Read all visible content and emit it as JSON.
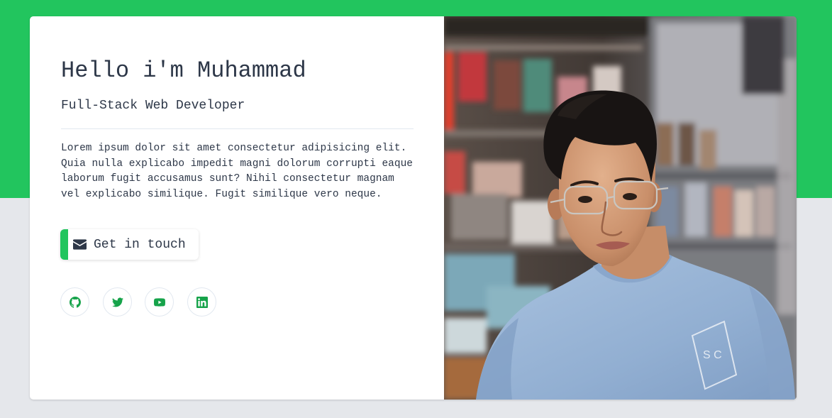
{
  "colors": {
    "accent": "#22c55e",
    "icon_green": "#16a34a",
    "text": "#2d3748",
    "page_background": "#e5e7eb",
    "card_background": "#ffffff"
  },
  "hero": {
    "title": "Hello i'm Muhammad",
    "subtitle": "Full-Stack Web Developer",
    "bio": "Lorem ipsum dolor sit amet consectetur adipisicing elit. Quia nulla explicabo impedit magni dolorum corrupti eaque laborum fugit accusamus sunt? Nihil consectetur magnam vel explicabo similique. Fugit similique vero neque.",
    "cta": {
      "label": "Get in touch",
      "icon": "envelope-icon"
    }
  },
  "social": [
    {
      "name": "GitHub",
      "icon": "github-icon"
    },
    {
      "name": "Twitter",
      "icon": "twitter-icon"
    },
    {
      "name": "YouTube",
      "icon": "youtube-icon"
    },
    {
      "name": "LinkedIn",
      "icon": "linkedin-icon"
    }
  ],
  "portrait": {
    "description": "portrait photo of a young man with glasses in a light blue sweatshirt, standing in front of store shelves",
    "shirt_text": "S C"
  }
}
